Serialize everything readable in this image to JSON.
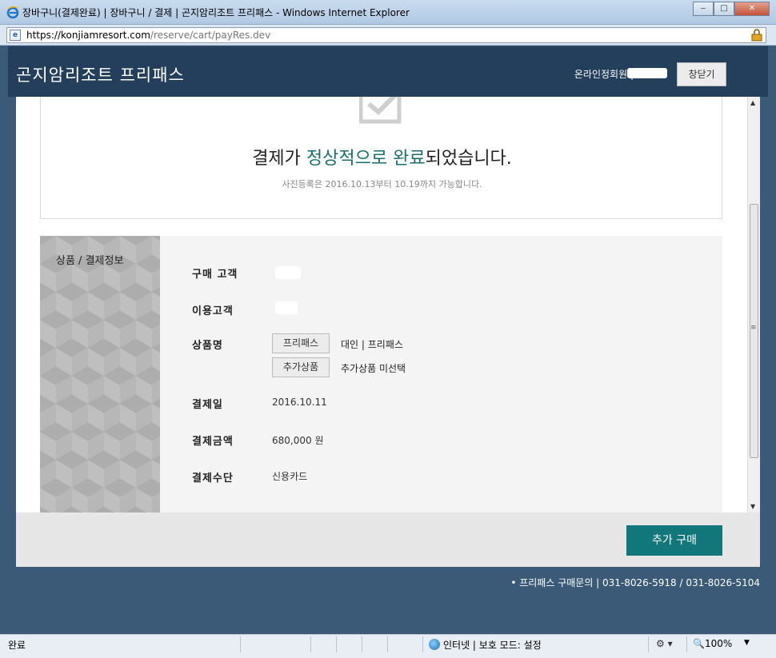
{
  "window": {
    "title": "장바구니(결제완료) | 장바구니 / 결제 | 곤지암리조트 프리패스 - Windows Internet Explorer",
    "url_main": "https://konjiamresort.com",
    "url_path": "/reserve/cart/payRes.dev",
    "minimize": "‒",
    "maximize": "□",
    "close": "✕"
  },
  "header": {
    "site_title": "곤지암리조트 프리패스",
    "member_label": "온라인정회원 |",
    "close_window_label": "창닫기"
  },
  "completion": {
    "msg_part1": "결제가 ",
    "msg_hl1": "정상적으로",
    "msg_space": " ",
    "msg_hl2": "완료",
    "msg_part2": "되었습니다.",
    "photo_notice": "사진등록은 2016.10.13부터 10.19까지 가능합니다."
  },
  "info": {
    "section_label": "상품 / 결제정보",
    "rows": {
      "buyer_label": "구매 고객",
      "user_label": "이용고객",
      "product_label": "상품명",
      "pay_date_label": "결제일",
      "pay_date_value": "2016.10.11",
      "amount_label": "결제금액",
      "amount_value": "680,000 원",
      "method_label": "결제수단",
      "method_value": "신용카드"
    },
    "products": [
      {
        "button": "프리패스",
        "desc": "대인 | 프리패스"
      },
      {
        "button": "추가상품",
        "desc": "추가상품 미선택"
      }
    ]
  },
  "actions": {
    "buy_more_label": "추가 구매"
  },
  "contact": "• 프리패스 구매문의 | 031-8026-5918 / 031-8026-5104",
  "statusbar": {
    "left": "완료",
    "zone": "인터넷 | 보호 모드: 설정",
    "zoom": "100%"
  },
  "colors": {
    "header_bg": "#243f5c",
    "accent": "#17706e",
    "button_primary": "#12777a"
  }
}
